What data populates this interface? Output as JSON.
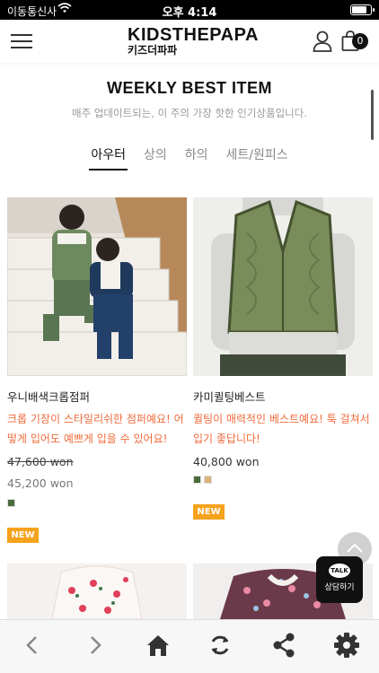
{
  "status_bar": {
    "carrier": "이동통신사",
    "time": "오후 4:14",
    "battery_level": 0.9
  },
  "header": {
    "logo_main": "KIDSTHEPAPA",
    "logo_sub": "키즈더파파",
    "menu_icon": "hamburger-icon",
    "user_icon": "user-icon",
    "cart_icon": "shopping-bag-icon",
    "cart_count": "0"
  },
  "section": {
    "title": "WEEKLY BEST ITEM",
    "subtitle": "매주 업데이트되는, 이 주의 가장 핫한 인기상품입니다."
  },
  "tabs": [
    {
      "label": "아우터",
      "active": true
    },
    {
      "label": "상의",
      "active": false
    },
    {
      "label": "하의",
      "active": false
    },
    {
      "label": "세트/원피스",
      "active": false
    }
  ],
  "products": [
    {
      "name": "우니배색크롭점퍼",
      "description": "크롭 기장이 스타일리쉬한 점퍼예요! 어떻게 입어도 예쁘게 입을 수 있어요!",
      "original_price": "47,600 won",
      "price": "45,200 won",
      "colors": [
        "#4a6b3a"
      ],
      "badge": "NEW"
    },
    {
      "name": "카미퀼팅베스트",
      "description": "퀼팅이 매력적인 베스트예요! 툭 걸쳐서 입기 좋답니다!",
      "price": "40,800 won",
      "colors": [
        "#4a6b3a",
        "#d6b57a"
      ],
      "badge": "NEW"
    }
  ],
  "floating": {
    "kakao_badge": "TALK",
    "kakao_label": "상담하기"
  },
  "toolbar": [
    "back-icon",
    "forward-icon",
    "home-icon",
    "refresh-icon",
    "share-icon",
    "settings-icon"
  ],
  "colors": {
    "accent": "#f06a3a",
    "badge": "#f5a21c"
  }
}
